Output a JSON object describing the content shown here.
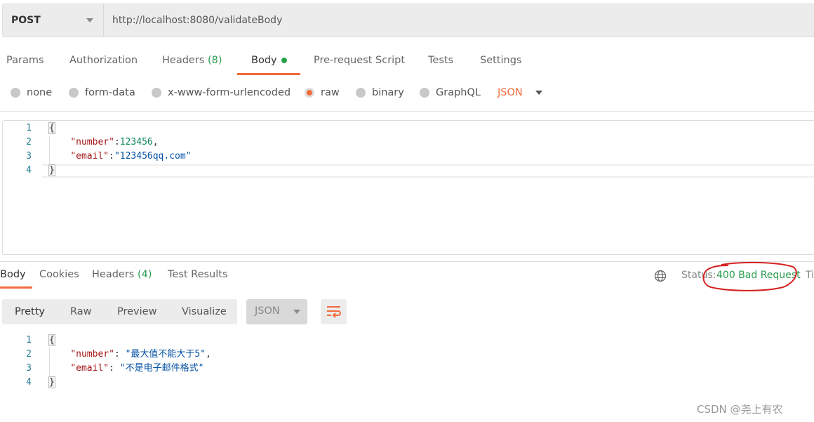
{
  "request": {
    "method": "POST",
    "url": "http://localhost:8080/validateBody"
  },
  "tabs": [
    {
      "label": "Params"
    },
    {
      "label": "Authorization"
    },
    {
      "label": "Headers",
      "count": "(8)"
    },
    {
      "label": "Body",
      "active": true
    },
    {
      "label": "Pre-request Script"
    },
    {
      "label": "Tests"
    },
    {
      "label": "Settings"
    }
  ],
  "body_types": [
    {
      "label": "none"
    },
    {
      "label": "form-data"
    },
    {
      "label": "x-www-form-urlencoded"
    },
    {
      "label": "raw",
      "selected": true
    },
    {
      "label": "binary"
    },
    {
      "label": "GraphQL"
    }
  ],
  "body_format": "JSON",
  "request_body": {
    "lines": [
      "1",
      "2",
      "3",
      "4"
    ],
    "open": "{",
    "close": "}",
    "number_key": "\"number\"",
    "number_value": "123456",
    "email_key": "\"email\"",
    "email_value": "\"123456qq.com\""
  },
  "response_tabs": [
    {
      "label": "Body",
      "active": true
    },
    {
      "label": "Cookies"
    },
    {
      "label": "Headers",
      "count": "(4)"
    },
    {
      "label": "Test Results"
    }
  ],
  "status": {
    "label": "Status:",
    "value": "400 Bad Request",
    "truncated_next": "Ti"
  },
  "view_modes": [
    {
      "label": "Pretty",
      "active": true
    },
    {
      "label": "Raw"
    },
    {
      "label": "Preview"
    },
    {
      "label": "Visualize"
    }
  ],
  "response_format": "JSON",
  "response_body": {
    "lines": [
      "1",
      "2",
      "3",
      "4"
    ],
    "open": "{",
    "close": "}",
    "number_key": "\"number\"",
    "number_value": "\"最大值不能大于5\"",
    "email_key": "\"email\"",
    "email_value": "\"不是电子邮件格式\""
  },
  "watermark": "CSDN @尧上有农",
  "colors": {
    "accent": "#f26b3a",
    "status_ok_green": "#2a9d4f",
    "annotation_red": "#d42020"
  }
}
